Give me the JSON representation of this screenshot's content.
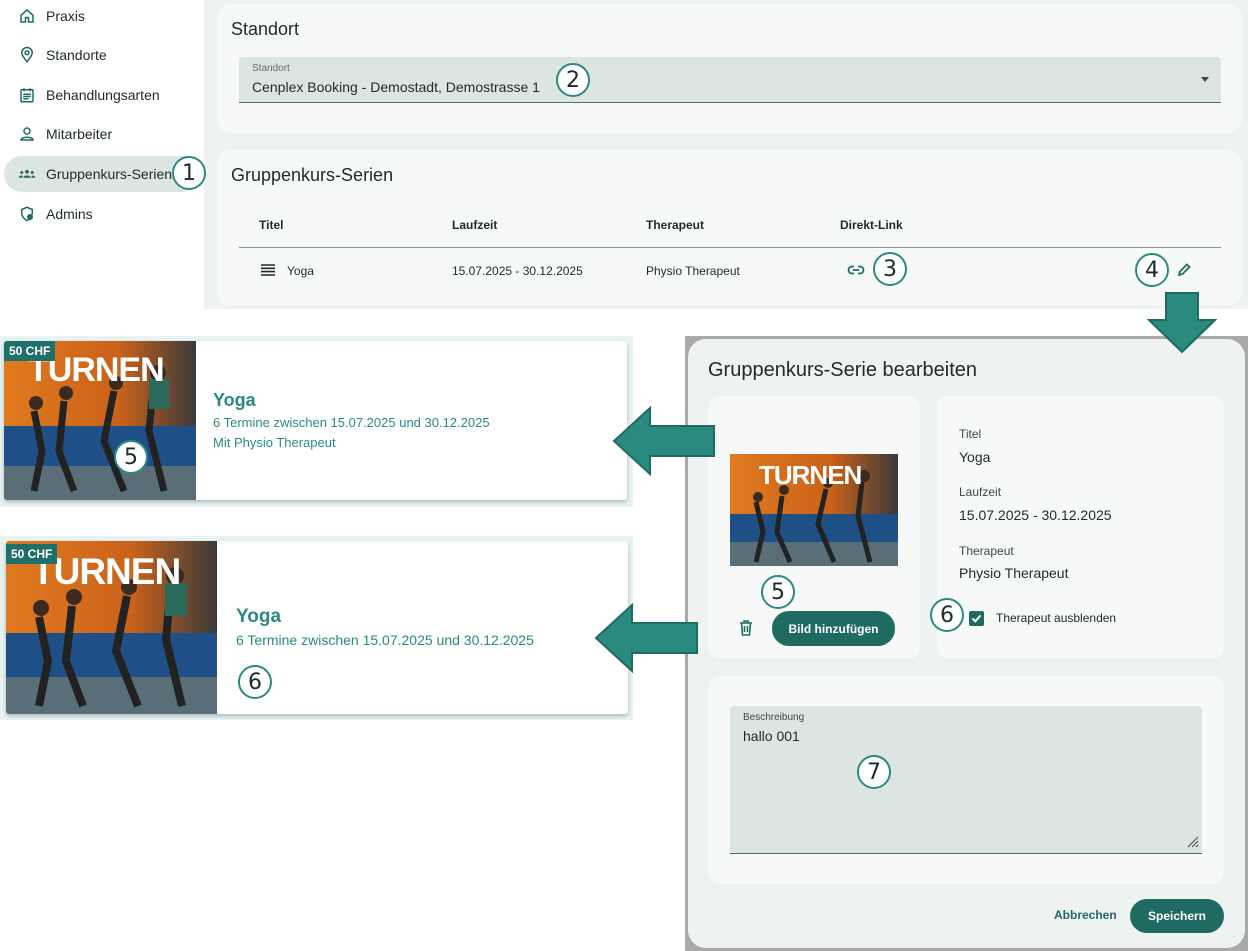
{
  "sidebar": {
    "items": [
      {
        "label": "Praxis",
        "icon": "home-icon"
      },
      {
        "label": "Standorte",
        "icon": "location-pin-icon"
      },
      {
        "label": "Behandlungsarten",
        "icon": "calendar-list-icon"
      },
      {
        "label": "Mitarbeiter",
        "icon": "person-icon"
      },
      {
        "label": "Gruppenkurs-Serien",
        "icon": "group-icon",
        "active": true
      },
      {
        "label": "Admins",
        "icon": "admin-shield-icon"
      }
    ]
  },
  "standort": {
    "title": "Standort",
    "select_label": "Standort",
    "select_value": "Cenplex Booking - Demostadt, Demostrasse 1"
  },
  "series": {
    "title": "Gruppenkurs-Serien",
    "headers": [
      "Titel",
      "Laufzeit",
      "Therapeut",
      "Direkt-Link"
    ],
    "rows": [
      {
        "titel": "Yoga",
        "laufzeit": "15.07.2025 - 30.12.2025",
        "therapeut": "Physio Therapeut"
      }
    ]
  },
  "badges": [
    "1",
    "2",
    "3",
    "4",
    "5",
    "5",
    "6",
    "6",
    "7"
  ],
  "preview1": {
    "price": "50 CHF",
    "image_text": "TURNEN",
    "title": "Yoga",
    "dates": "6 Termine zwischen 15.07.2025 und 30.12.2025",
    "therapist": "Mit Physio Therapeut"
  },
  "preview2": {
    "price": "50 CHF",
    "image_text": "TURNEN",
    "title": "Yoga",
    "dates": "6 Termine zwischen 15.07.2025 und 30.12.2025"
  },
  "dialog": {
    "title": "Gruppenkurs-Serie bearbeiten",
    "image_text": "TURNEN",
    "add_image_label": "Bild hinzufügen",
    "titel_label": "Titel",
    "titel_value": "Yoga",
    "laufzeit_label": "Laufzeit",
    "laufzeit_value": "15.07.2025 - 30.12.2025",
    "therapeut_label": "Therapeut",
    "therapeut_value": "Physio Therapeut",
    "hide_therapist_label": "Therapeut ausblenden",
    "hide_therapist_checked": true,
    "beschreibung_label": "Beschreibung",
    "beschreibung_value": "hallo 001",
    "cancel_label": "Abbrechen",
    "save_label": "Speichern"
  },
  "colors": {
    "accent": "#1f6b62",
    "teal_text": "#2a8a80",
    "arrow": "#2a8a80"
  }
}
